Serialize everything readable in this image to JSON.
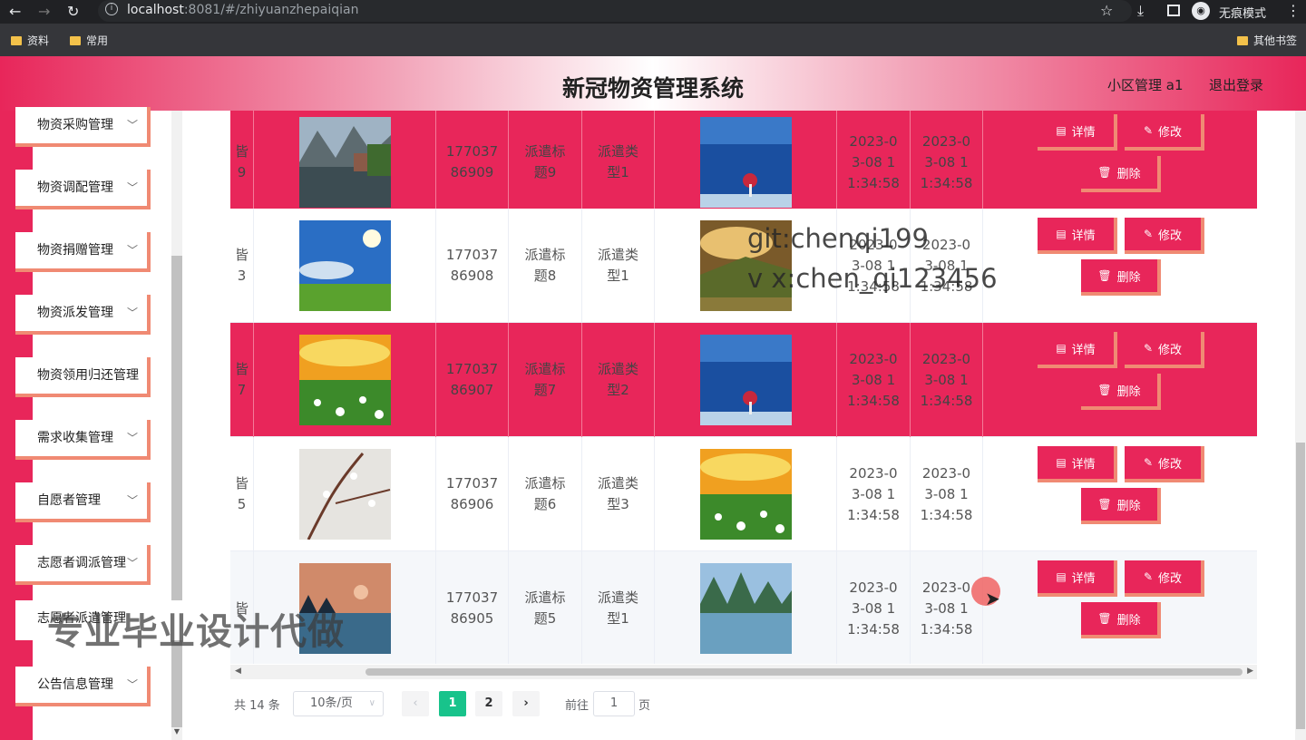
{
  "browser": {
    "url_host": "localhost",
    "url_path": ":8081/#/zhiyuanzhepaiqian",
    "incognito_label": "无痕模式",
    "bookmarks": [
      "资料",
      "常用"
    ],
    "other_bookmarks": "其他书签",
    "icons": [
      "back-icon",
      "forward-icon",
      "reload-icon",
      "info-icon",
      "star-icon",
      "download-icon",
      "panel-icon",
      "incognito-icon",
      "menu-kebab-icon"
    ]
  },
  "header": {
    "title": "新冠物资管理系统",
    "user": "小区管理 a1",
    "logout": "退出登录"
  },
  "sidebar": {
    "items": [
      {
        "label": "物资采购管理",
        "chev": "﹀"
      },
      {
        "label": "物资调配管理",
        "chev": "﹀"
      },
      {
        "label": "物资捐赠管理",
        "chev": "﹀"
      },
      {
        "label": "物资派发管理",
        "chev": "﹀"
      },
      {
        "label": "物资领用归还管理",
        "chev": ""
      },
      {
        "label": "需求收集管理",
        "chev": "﹀"
      },
      {
        "label": "自愿者管理",
        "chev": "﹀"
      },
      {
        "label": "志愿者调派管理",
        "chev": "﹀"
      },
      {
        "label": "志愿者派遣管理",
        "chev": ""
      },
      {
        "label": "公告信息管理",
        "chev": "﹀"
      }
    ]
  },
  "table": {
    "rows": [
      {
        "name_frag": "皆\n9",
        "account": "177037\n86909",
        "title": "派遣标\n题9",
        "type": "派遣类\n型1",
        "time1": "2023-0\n3-08 1\n1:34:58",
        "time2": "2023-0\n3-08 1\n1:34:58",
        "style": "pink",
        "img1": "mountain-lake-village",
        "img2": "blue-sea-red-umbrella"
      },
      {
        "name_frag": "皆\n3",
        "account": "177037\n86908",
        "title": "派遣标\n题8",
        "type": "派遣类\n型1",
        "time1": "2023-0\n3-08 1\n1:34:58",
        "time2": "2023-0\n3-08 1\n1:34:58",
        "style": "white",
        "img1": "blue-sky-grass",
        "img2": "golden-hills"
      },
      {
        "name_frag": "皆\n7",
        "account": "177037\n86907",
        "title": "派遣标\n题7",
        "type": "派遣类\n型2",
        "time1": "2023-0\n3-08 1\n1:34:58",
        "time2": "2023-0\n3-08 1\n1:34:58",
        "style": "pink",
        "img1": "sunset-daisies",
        "img2": "blue-sea-red-umbrella"
      },
      {
        "name_frag": "皆\n5",
        "account": "177037\n86906",
        "title": "派遣标\n题6",
        "type": "派遣类\n型3",
        "time1": "2023-0\n3-08 1\n1:34:58",
        "time2": "2023-0\n3-08 1\n1:34:58",
        "style": "white",
        "img1": "blossom-branches",
        "img2": "sunset-daisies"
      },
      {
        "name_frag": "皆\n",
        "account": "177037\n86905",
        "title": "派遣标\n题5",
        "type": "派遣类\n型1",
        "time1": "2023-0\n3-08 1\n1:34:58",
        "time2": "2023-0\n3-08 1\n1:34:58",
        "style": "hover",
        "img1": "dusk-lake-moon",
        "img2": "karst-river"
      }
    ],
    "actions": {
      "detail": "详情",
      "edit": "修改",
      "delete": "删除"
    }
  },
  "pagination": {
    "total": "共 14 条",
    "page_size": "10条/页",
    "pages": [
      "1",
      "2"
    ],
    "current": "1",
    "goto_prefix": "前往",
    "goto_value": "1",
    "goto_suffix": "页"
  },
  "overlays": {
    "watermark_line1": "git:chenqi199",
    "watermark_line2": "v x:chen_qi123456",
    "watermark_big": "专业毕业设计代做"
  },
  "colors": {
    "accent": "#e8265a",
    "button_shadow": "#f08a73",
    "page_active": "#18c38b"
  }
}
